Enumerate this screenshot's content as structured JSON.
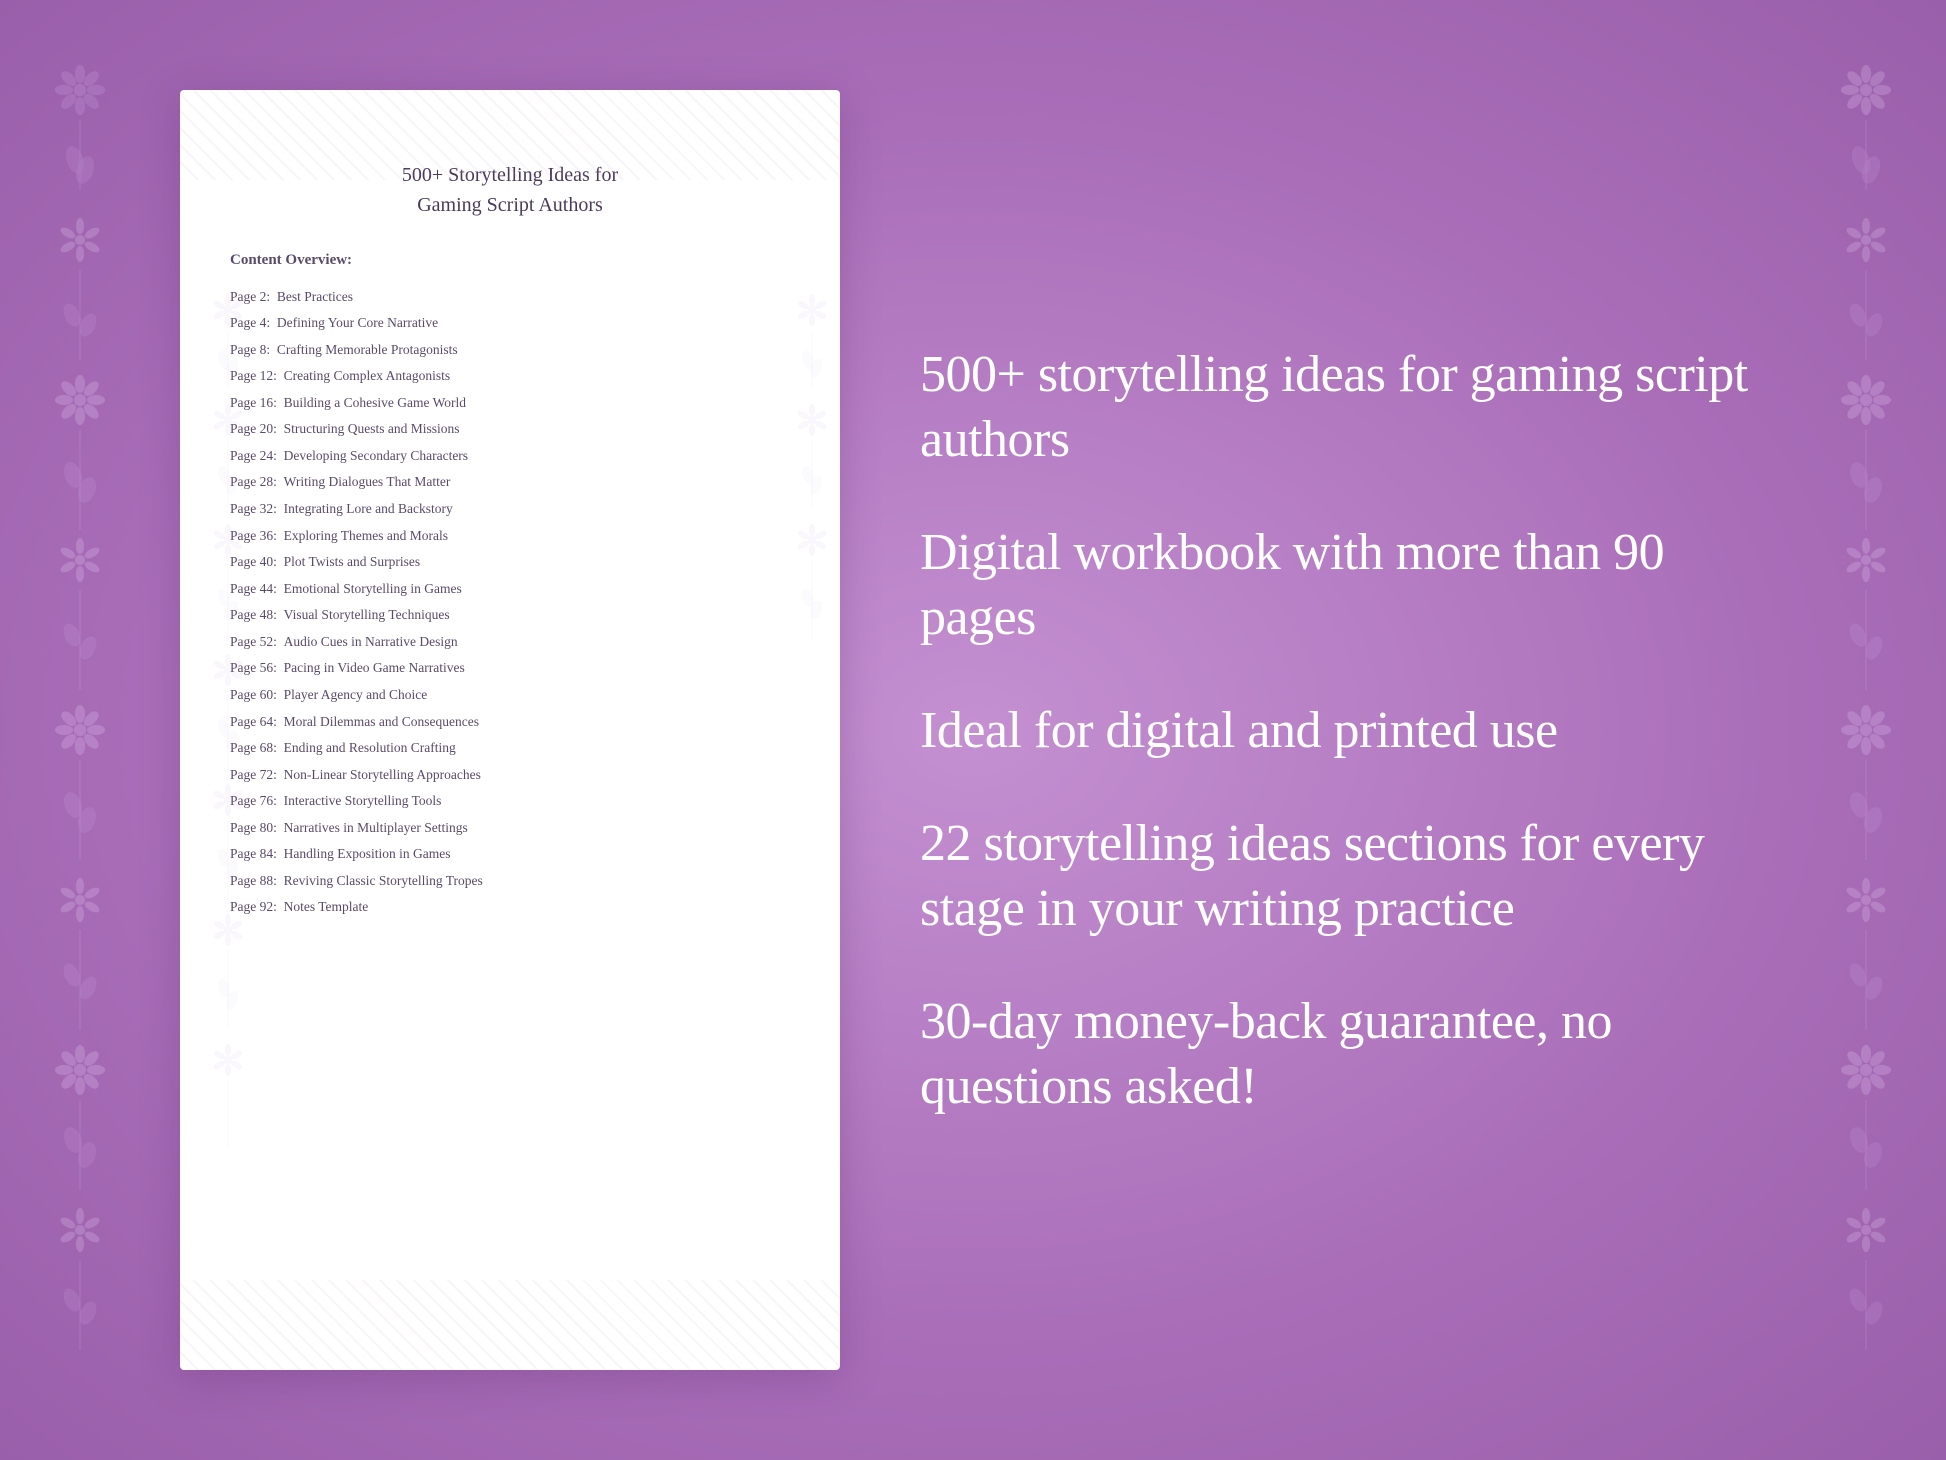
{
  "background": {
    "color": "#b87fc4"
  },
  "document": {
    "title_line1": "500+ Storytelling Ideas for",
    "title_line2": "Gaming Script Authors",
    "section_label": "Content Overview:",
    "toc": [
      {
        "page": "Page  2:",
        "topic": "Best Practices"
      },
      {
        "page": "Page  4:",
        "topic": "Defining Your Core Narrative"
      },
      {
        "page": "Page  8:",
        "topic": "Crafting Memorable Protagonists"
      },
      {
        "page": "Page 12:",
        "topic": "Creating Complex Antagonists"
      },
      {
        "page": "Page 16:",
        "topic": "Building a Cohesive Game World"
      },
      {
        "page": "Page 20:",
        "topic": "Structuring Quests and Missions"
      },
      {
        "page": "Page 24:",
        "topic": "Developing Secondary Characters"
      },
      {
        "page": "Page 28:",
        "topic": "Writing Dialogues That Matter"
      },
      {
        "page": "Page 32:",
        "topic": "Integrating Lore and Backstory"
      },
      {
        "page": "Page 36:",
        "topic": "Exploring Themes and Morals"
      },
      {
        "page": "Page 40:",
        "topic": "Plot Twists and Surprises"
      },
      {
        "page": "Page 44:",
        "topic": "Emotional Storytelling in Games"
      },
      {
        "page": "Page 48:",
        "topic": "Visual Storytelling Techniques"
      },
      {
        "page": "Page 52:",
        "topic": "Audio Cues in Narrative Design"
      },
      {
        "page": "Page 56:",
        "topic": "Pacing in Video Game Narratives"
      },
      {
        "page": "Page 60:",
        "topic": "Player Agency and Choice"
      },
      {
        "page": "Page 64:",
        "topic": "Moral Dilemmas and Consequences"
      },
      {
        "page": "Page 68:",
        "topic": "Ending and Resolution Crafting"
      },
      {
        "page": "Page 72:",
        "topic": "Non-Linear Storytelling Approaches"
      },
      {
        "page": "Page 76:",
        "topic": "Interactive Storytelling Tools"
      },
      {
        "page": "Page 80:",
        "topic": "Narratives in Multiplayer Settings"
      },
      {
        "page": "Page 84:",
        "topic": "Handling Exposition in Games"
      },
      {
        "page": "Page 88:",
        "topic": "Reviving Classic Storytelling Tropes"
      },
      {
        "page": "Page 92:",
        "topic": "Notes Template"
      }
    ]
  },
  "features": [
    {
      "id": "feature-1",
      "text": "500+ storytelling ideas for gaming script authors"
    },
    {
      "id": "feature-2",
      "text": "Digital workbook with more than 90 pages"
    },
    {
      "id": "feature-3",
      "text": "Ideal for digital and printed use"
    },
    {
      "id": "feature-4",
      "text": "22 storytelling ideas sections for every stage in your writing practice"
    },
    {
      "id": "feature-5",
      "text": "30-day money-back guarantee, no questions asked!"
    }
  ]
}
